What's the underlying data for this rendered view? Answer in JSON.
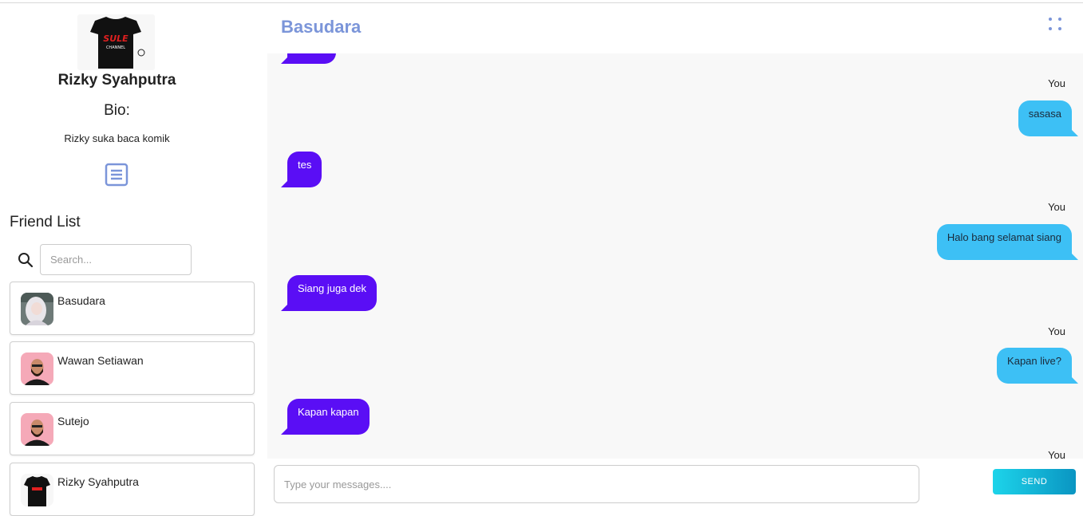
{
  "profile": {
    "name": "Rizky Syahputra",
    "bio_label": "Bio:",
    "bio_text": "Rizky suka baca komik",
    "shirt_text": "SULE",
    "shirt_subtext": "CHANNEL"
  },
  "friends": {
    "title": "Friend List",
    "search_placeholder": "Search...",
    "items": [
      {
        "name": "Basudara"
      },
      {
        "name": "Wawan Setiawan"
      },
      {
        "name": "Sutejo"
      },
      {
        "name": "Rizky Syahputra"
      }
    ]
  },
  "chat": {
    "title": "Basudara",
    "you_label": "You",
    "messages": [
      {
        "from": "you",
        "text": "sasasa"
      },
      {
        "from": "them",
        "text": "tes"
      },
      {
        "from": "you",
        "text": "Halo bang selamat siang"
      },
      {
        "from": "them",
        "text": "Siang juga dek"
      },
      {
        "from": "you",
        "text": "Kapan live?"
      },
      {
        "from": "them",
        "text": "Kapan kapan"
      }
    ]
  },
  "composer": {
    "placeholder": "Type your messages....",
    "send_label": "SEND"
  },
  "colors": {
    "accent": "#7b95d9",
    "outgoing": "#3dc0f5",
    "incoming": "#5a0ef5"
  }
}
